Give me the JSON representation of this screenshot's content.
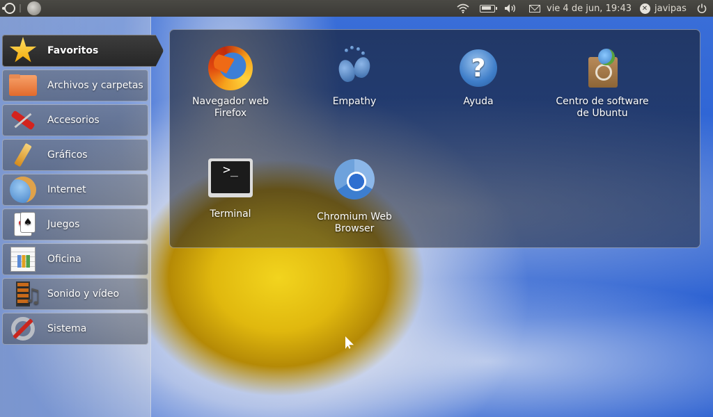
{
  "top_panel": {
    "clock": "vie  4 de jun, 19:43",
    "username": "javipas",
    "icons": [
      "ubuntu-logo-icon",
      "app-indicator-icon",
      "wifi-icon",
      "battery-icon",
      "volume-icon",
      "mail-icon",
      "user-status-icon",
      "power-icon"
    ],
    "status_glyph": "✕"
  },
  "sidebar": {
    "categories": [
      {
        "label": "Favoritos",
        "icon": "star-icon",
        "active": true
      },
      {
        "label": "Archivos y carpetas",
        "icon": "folder-icon"
      },
      {
        "label": "Accesorios",
        "icon": "accessories-icon"
      },
      {
        "label": "Gráficos",
        "icon": "graphics-icon"
      },
      {
        "label": "Internet",
        "icon": "internet-icon"
      },
      {
        "label": "Juegos",
        "icon": "games-icon"
      },
      {
        "label": "Oficina",
        "icon": "office-icon"
      },
      {
        "label": "Sonido y vídeo",
        "icon": "multimedia-icon"
      },
      {
        "label": "Sistema",
        "icon": "system-icon"
      }
    ]
  },
  "favorites": {
    "apps": [
      {
        "label": "Navegador web\nFirefox",
        "icon": "firefox-icon"
      },
      {
        "label": "Empathy",
        "icon": "empathy-icon"
      },
      {
        "label": "Ayuda",
        "icon": "help-icon"
      },
      {
        "label": "Centro de software\nde Ubuntu",
        "icon": "software-center-icon"
      },
      {
        "label": "Terminal",
        "icon": "terminal-icon"
      },
      {
        "label": "Chromium Web\nBrowser",
        "icon": "chromium-icon"
      }
    ]
  },
  "glyphs": {
    "help": "?",
    "terminal": ">_",
    "hearts": "♥",
    "spades": "♠",
    "note": "♫"
  }
}
